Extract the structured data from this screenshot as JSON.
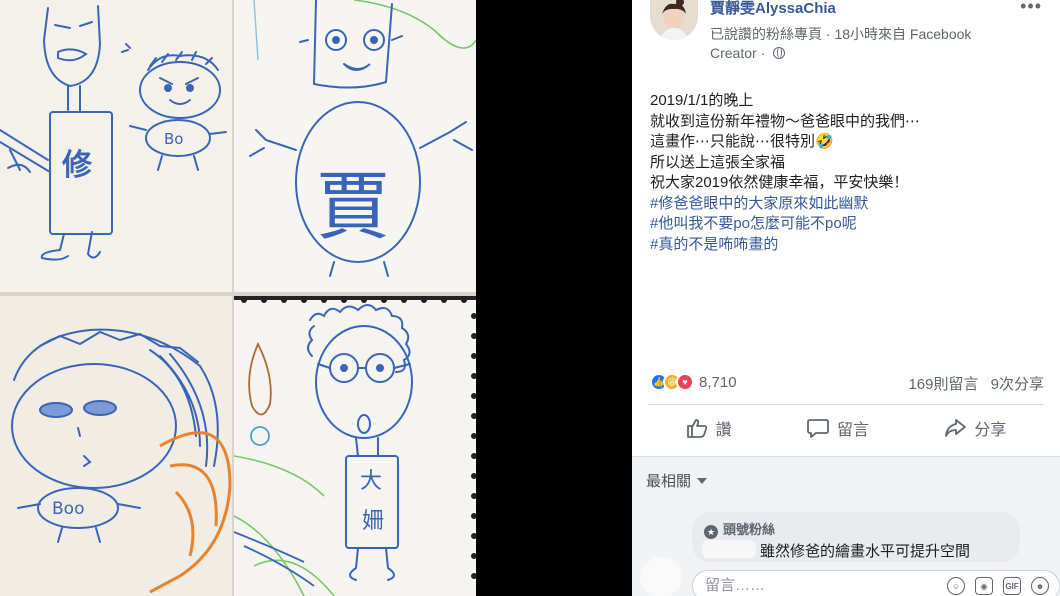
{
  "post": {
    "author": "賈靜雯AlyssaChia",
    "page_type": "已說讚的粉絲專頁",
    "time_meta": "18小時來自 Facebook",
    "meta_separator": "·",
    "creator_label": "Creator",
    "body_lines": [
      "2019/1/1的晚上",
      "就收到這份新年禮物～爸爸眼中的我們⋯",
      "這畫作⋯只能說⋯很特別🤣",
      "所以送上這張全家福",
      "祝大家2019依然健康幸福，平安快樂！"
    ],
    "hashtags": [
      "#修爸爸眼中的大家原來如此幽默",
      "#他叫我不要po怎麼可能不po呢",
      "#真的不是咘咘畫的"
    ]
  },
  "reactions": {
    "count": "8,710",
    "comments": "169則留言",
    "shares": "9次分享",
    "types": [
      "like",
      "haha",
      "love"
    ]
  },
  "actions": {
    "like": "讚",
    "comment": "留言",
    "share": "分享"
  },
  "comments": {
    "sort_label": "最相關",
    "fan_badge": "頭號粉絲",
    "first_comment": "雖然修爸的繪畫水平可提升空間",
    "composer_placeholder": "留言……",
    "composer_icons": [
      "emoji-icon",
      "camera-icon",
      "gif-icon",
      "sticker-icon"
    ]
  },
  "drawings": {
    "labels": [
      "修",
      "Bo",
      "賈",
      "Boo",
      "大",
      "姍"
    ]
  },
  "colors": {
    "link": "#385898",
    "text": "#1c1e21",
    "secondary": "#606770",
    "crayon_blue": "#3a64b8",
    "crayon_orange": "#e8822c"
  }
}
